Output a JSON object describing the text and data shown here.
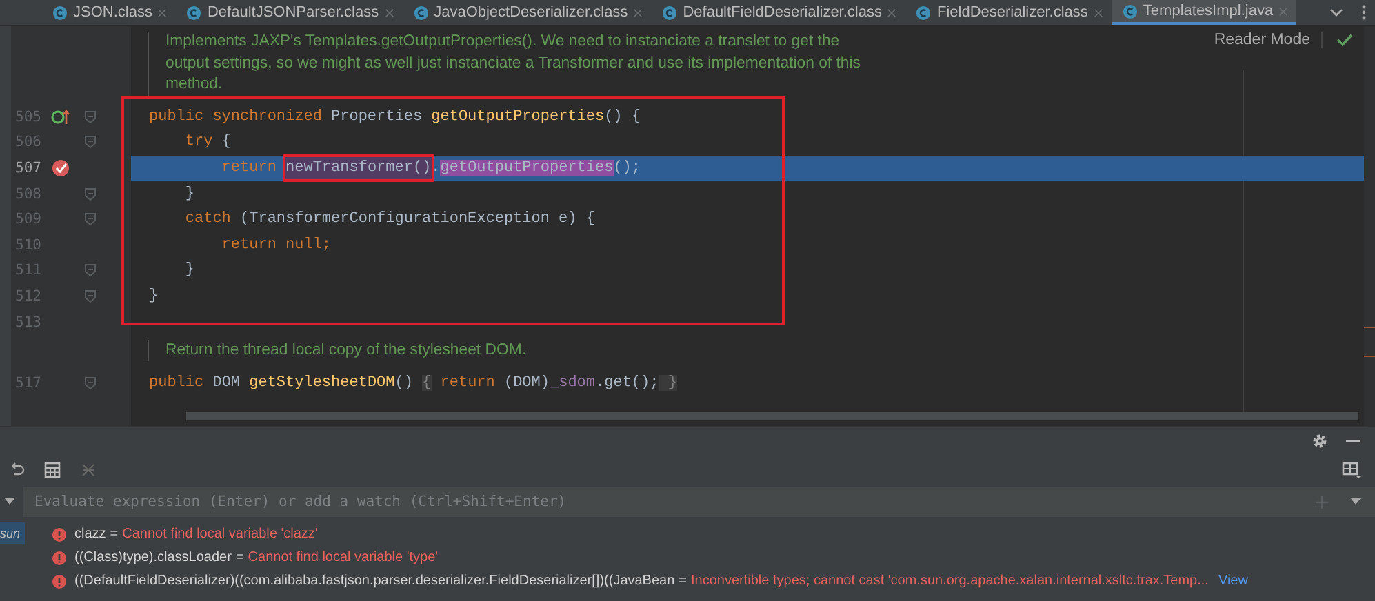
{
  "tabs": [
    {
      "label": "JSON.class",
      "selected": false
    },
    {
      "label": "DefaultJSONParser.class",
      "selected": false
    },
    {
      "label": "JavaObjectDeserializer.class",
      "selected": false
    },
    {
      "label": "DefaultFieldDeserializer.class",
      "selected": false
    },
    {
      "label": "FieldDeserializer.class",
      "selected": false
    },
    {
      "label": "TemplatesImpl.java",
      "selected": true
    }
  ],
  "editor": {
    "reader_mode": "Reader Mode",
    "sections": [
      {
        "kind": "doc",
        "lines": [
          "Implements JAXP's Templates.getOutputProperties(). We need to instanciate a translet to get the",
          "output settings, so we might as well just instanciate a Transformer and use its implementation of this",
          "method."
        ]
      },
      {
        "kind": "code",
        "boxed": true,
        "lines": [
          {
            "number": "505",
            "gutter": {
              "kind": "override"
            },
            "fold": true,
            "current": false,
            "tokens": [
              {
                "text": "public synchronized ",
                "kind": "keyword"
              },
              {
                "text": "Properties ",
                "kind": "plain"
              },
              {
                "text": "getOutputProperties",
                "kind": "method"
              },
              {
                "text": "() {",
                "kind": "plain"
              }
            ]
          },
          {
            "number": "506",
            "fold": true,
            "current": false,
            "tokens": [
              {
                "text": "    try",
                "kind": "keyword"
              },
              {
                "text": " {",
                "kind": "plain"
              }
            ]
          },
          {
            "number": "507",
            "gutter": {
              "kind": "breakpoint"
            },
            "fold": false,
            "current": true,
            "tokens": [
              {
                "text": "        return ",
                "kind": "keyword"
              },
              {
                "text": "newTransformer()",
                "kind": "usage",
                "boxed": true
              },
              {
                "text": ".",
                "kind": "plain"
              },
              {
                "text": "getOutputProperties",
                "kind": "match"
              },
              {
                "text": "();",
                "kind": "plain"
              }
            ]
          },
          {
            "number": "508",
            "fold": true,
            "current": false,
            "tokens": [
              {
                "text": "    }",
                "kind": "plain"
              }
            ]
          },
          {
            "number": "509",
            "fold": true,
            "current": false,
            "tokens": [
              {
                "text": "    catch",
                "kind": "keyword"
              },
              {
                "text": " (TransformerConfigurationException e) {",
                "kind": "plain"
              }
            ]
          },
          {
            "number": "510",
            "fold": false,
            "current": false,
            "tokens": [
              {
                "text": "        return null;",
                "kind": "keyword"
              }
            ]
          },
          {
            "number": "511",
            "fold": true,
            "current": false,
            "tokens": [
              {
                "text": "    }",
                "kind": "plain"
              }
            ]
          },
          {
            "number": "512",
            "fold": true,
            "current": false,
            "tokens": [
              {
                "text": "}",
                "kind": "plain"
              }
            ]
          }
        ]
      },
      {
        "kind": "code",
        "boxed": false,
        "lines": [
          {
            "number": "513",
            "fold": false,
            "current": false
          }
        ]
      },
      {
        "kind": "doc",
        "lines": [
          "Return the thread local copy of the stylesheet DOM."
        ]
      },
      {
        "kind": "code",
        "boxed": false,
        "lines": [
          {
            "number": "517",
            "fold": true,
            "current": false,
            "tokens": [
              {
                "text": "public ",
                "kind": "keyword"
              },
              {
                "text": "DOM ",
                "kind": "plain"
              },
              {
                "text": "getStylesheetDOM",
                "kind": "method"
              },
              {
                "text": "() ",
                "kind": "plain"
              },
              {
                "text": "{",
                "kind": "folded"
              },
              {
                "text": " return ",
                "kind": "keyword"
              },
              {
                "text": "(DOM)",
                "kind": "plain"
              },
              {
                "text": "_sdom",
                "kind": "field"
              },
              {
                "text": ".get();",
                "kind": "plain"
              },
              {
                "text": " }",
                "kind": "folded"
              }
            ]
          }
        ]
      }
    ]
  },
  "debugger": {
    "side_label": "sun",
    "expression_placeholder": "Evaluate expression (Enter) or add a watch (Ctrl+Shift+Enter)",
    "watches": [
      {
        "kind": "error",
        "name": "clazz",
        "operator": "=",
        "value": "Cannot find local variable 'clazz'"
      },
      {
        "kind": "error",
        "name": "((Class)type).classLoader",
        "operator": "=",
        "value": "Cannot find local variable 'type'"
      },
      {
        "kind": "error",
        "name": "((DefaultFieldDeserializer)((com.alibaba.fastjson.parser.deserializer.FieldDeserializer[])((JavaBean",
        "operator": "=",
        "value": "Inconvertible types; cannot cast 'com.sun.org.apache.xalan.internal.xsltc.trax.Temp...",
        "link": "View"
      }
    ]
  }
}
